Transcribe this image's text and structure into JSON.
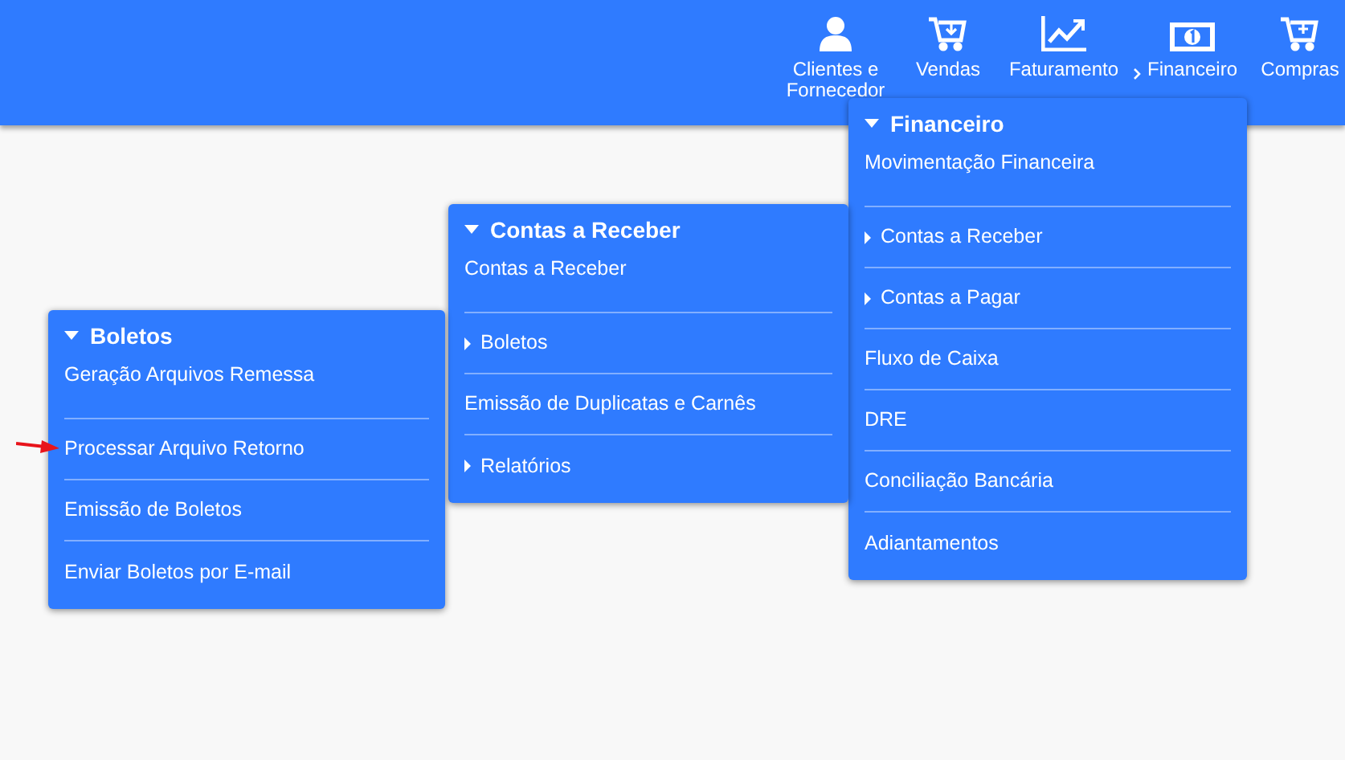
{
  "nav": [
    {
      "lines": [
        "Clientes e",
        "Fornecedor"
      ],
      "current": false
    },
    {
      "lines": [
        "Vendas"
      ],
      "current": false
    },
    {
      "lines": [
        "Faturamento"
      ],
      "current": false
    },
    {
      "lines": [
        "Financeiro"
      ],
      "current": true
    },
    {
      "lines": [
        "Compras"
      ],
      "current": false
    }
  ],
  "menus": [
    {
      "title": "Financeiro",
      "items": [
        {
          "label": "Movimentação Financeira",
          "kind": "link"
        },
        {
          "label": "Contas a Receber",
          "kind": "submenu"
        },
        {
          "label": "Contas a Pagar",
          "kind": "submenu"
        },
        {
          "label": "Fluxo de Caixa",
          "kind": "link"
        },
        {
          "label": "DRE",
          "kind": "link"
        },
        {
          "label": "Conciliação Bancária",
          "kind": "link"
        },
        {
          "label": "Adiantamentos",
          "kind": "link"
        }
      ]
    },
    {
      "title": "Contas a Receber",
      "items": [
        {
          "label": "Contas a Receber",
          "kind": "link"
        },
        {
          "label": "Boletos",
          "kind": "submenu"
        },
        {
          "label": "Emissão de Duplicatas e Carnês",
          "kind": "link"
        },
        {
          "label": "Relatórios",
          "kind": "submenu"
        }
      ]
    },
    {
      "title": "Boletos",
      "items": [
        {
          "label": "Geração Arquivos Remessa",
          "kind": "link",
          "pointed": false
        },
        {
          "label": "Processar Arquivo Retorno",
          "kind": "link",
          "pointed": true
        },
        {
          "label": "Emissão de Boletos",
          "kind": "link",
          "pointed": false
        },
        {
          "label": "Enviar Boletos por E-mail",
          "kind": "link",
          "pointed": false
        }
      ]
    }
  ]
}
